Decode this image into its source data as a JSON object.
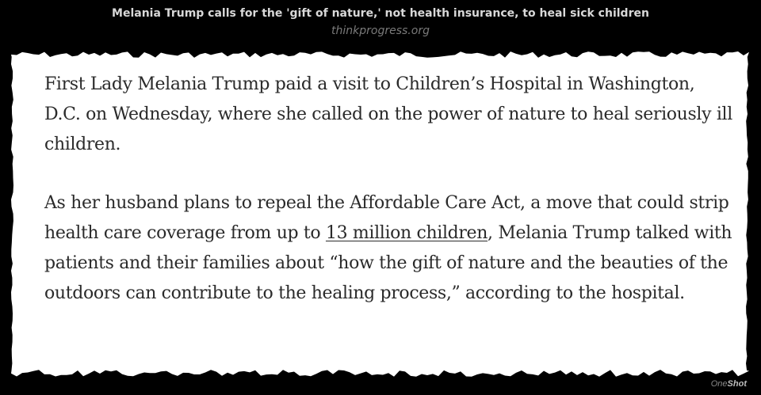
{
  "header": {
    "headline": "Melania Trump calls for the 'gift of nature,' not health insurance, to heal sick children",
    "source": "thinkprogress.org"
  },
  "article": {
    "paragraph_1": "First Lady Melania Trump paid a visit to Children’s Hospital in Washington, D.C. on Wednesday, where she called on the power of nature to heal seriously ill children.",
    "paragraph_2_before_link": "As her husband plans to repeal the Affordable Care Act, a move that could strip health care coverage from up to ",
    "paragraph_2_link": "13 million children",
    "paragraph_2_after_link": ", Melania Trump talked with patients and their families about “how the gift of nature and the beauties of the outdoors can contribute to the healing process,” according to the hospital."
  },
  "watermark": {
    "prefix": "One",
    "suffix": "Shot"
  },
  "colors": {
    "background": "#000000",
    "paper": "#ffffff",
    "headline": "#d8d8d8",
    "source": "#7a7a7a",
    "body_text": "#2a2a2a"
  }
}
